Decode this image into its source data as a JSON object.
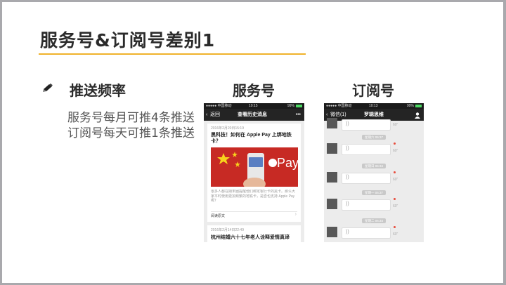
{
  "slide": {
    "title": "服务号&订阅号差别1",
    "bullet_label": "推送频率",
    "body_lines": [
      "服务号每月可推4条推送",
      "订阅号每天可推1条推送"
    ],
    "column_labels": {
      "service": "服务号",
      "subscription": "订阅号"
    }
  },
  "service_phone": {
    "status_left": "●●●●● 中国移动",
    "status_time": "10:15",
    "status_right": "99%",
    "back_label": "返回",
    "nav_title": "查看历史消息",
    "more_label": "•••",
    "article1": {
      "date": "2016年2月20日15:19",
      "headline": "黑科技！如何在 Apple Pay 上绑地铁卡？",
      "summary": "很多人都在期末圈提醒他们绑定银行卡的黑卡。那么大家平时使用更加频繁的地铁卡，是否也支持 Apple Pay 呢？",
      "read_more": "阅读原文",
      "chevron": "›",
      "image_text": "Pay"
    },
    "article2": {
      "date": "2016年2月14日22:49",
      "headline": "杭州结婚六十七年老人诠释爱情真谛"
    }
  },
  "sub_phone": {
    "status_left": "●●●●● 中国移动",
    "status_time": "10:13",
    "status_right": "99%",
    "back_label": "微信(1)",
    "nav_title": "罗辑思维",
    "voice_glyph": "))",
    "duration": "60\"",
    "timestamps": [
      "星期六 06:37",
      "星期日 06:34",
      "星期一 06:37",
      "星期二 06:34"
    ]
  }
}
